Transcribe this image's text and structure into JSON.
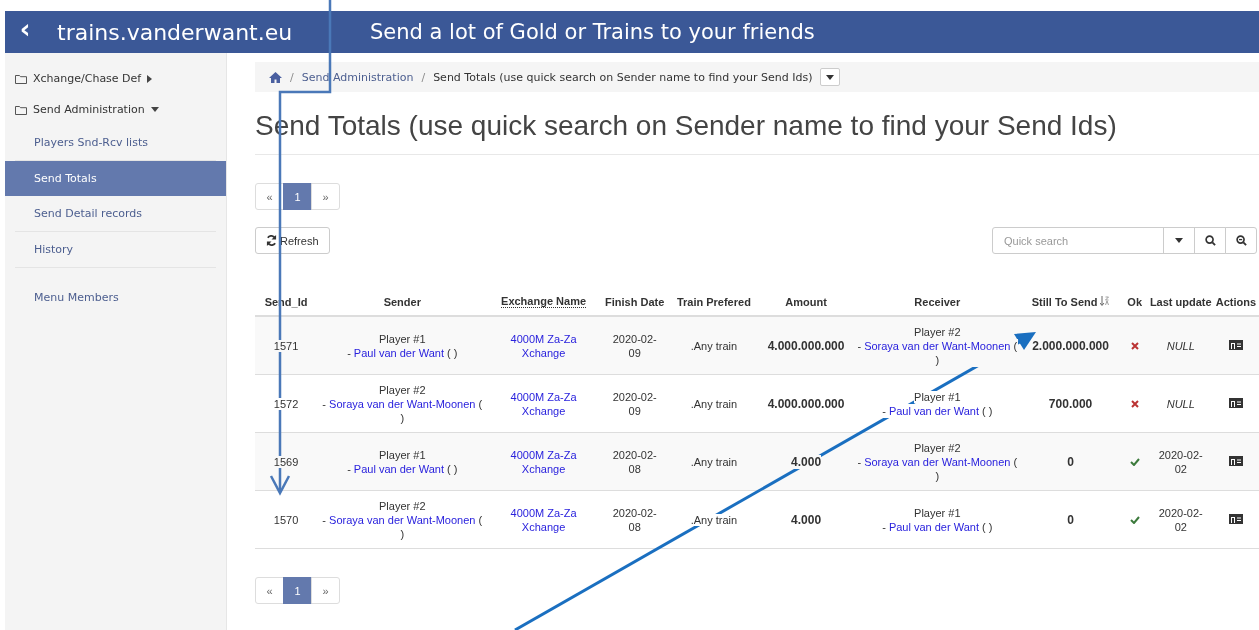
{
  "topbar": {
    "back": "‹",
    "site": "trains.vanderwant.eu",
    "tagline": "Send a lot of Gold or Trains to your friends"
  },
  "sidebar": {
    "items": [
      {
        "label": "Xchange/Chase Def",
        "expanded": false
      },
      {
        "label": "Send Administration",
        "expanded": true,
        "children": [
          {
            "label": "Players Snd-Rcv lists",
            "selected": false
          },
          {
            "label": "Send Totals",
            "selected": true
          },
          {
            "label": "Send Detail records",
            "selected": false
          },
          {
            "label": "History",
            "selected": false
          },
          {
            "label": "Menu Members",
            "selected": false
          }
        ]
      }
    ]
  },
  "breadcrumb": {
    "separator": "/",
    "items": [
      "Send Administration",
      "Send Totals (use quick search on Sender name to find your Send Ids)"
    ]
  },
  "page_title": "Send Totals (use quick search on Sender name to find your Send Ids)",
  "pager_top": [
    {
      "label": "«",
      "selected": false
    },
    {
      "label": "1",
      "selected": true
    },
    {
      "label": "»",
      "selected": false
    }
  ],
  "refresh": "Refresh",
  "search": {
    "placeholder": "Quick search"
  },
  "table": {
    "columns": [
      {
        "label": "Send_Id",
        "kind": "plain"
      },
      {
        "label": "Sender",
        "kind": "plain"
      },
      {
        "label": "Exchange Name",
        "kind": "dotted"
      },
      {
        "label": "Finish Date",
        "kind": "plain"
      },
      {
        "label": "Train Prefered",
        "kind": "plain"
      },
      {
        "label": "Amount",
        "kind": "plain"
      },
      {
        "label": "Receiver",
        "kind": "plain"
      },
      {
        "label": "Still To Send",
        "kind": "sorted"
      },
      {
        "label": "Ok",
        "kind": "plain"
      },
      {
        "label": "Last update",
        "kind": "plain"
      },
      {
        "label": "Actions",
        "kind": "plain"
      }
    ],
    "rows": [
      {
        "id": "1571",
        "sender": {
          "player": "Player #1",
          "dash": "-",
          "name": "Paul van der Want",
          "suffix": "( )"
        },
        "exchange": "4000M Za-Za Xchange",
        "finish": "2020-02-09",
        "train": ".Any train",
        "amount": "4.000.000.000",
        "receiver": {
          "player": "Player #2",
          "dash": "-",
          "name": "Soraya van der Want-Moonen",
          "suffix": "( )"
        },
        "still": "2.000.000.000",
        "ok": false,
        "last_update": {
          "text": "NULL",
          "kind": "null"
        }
      },
      {
        "id": "1572",
        "sender": {
          "player": "Player #2",
          "dash": "-",
          "name": "Soraya van der Want-Moonen",
          "suffix": "( )"
        },
        "exchange": "4000M Za-Za Xchange",
        "finish": "2020-02-09",
        "train": ".Any train",
        "amount": "4.000.000.000",
        "receiver": {
          "player": "Player #1",
          "dash": "-",
          "name": "Paul van der Want",
          "suffix": "( )"
        },
        "still": "700.000",
        "ok": false,
        "last_update": {
          "text": "NULL",
          "kind": "null"
        }
      },
      {
        "id": "1569",
        "sender": {
          "player": "Player #1",
          "dash": "-",
          "name": "Paul van der Want",
          "suffix": "( )"
        },
        "exchange": "4000M Za-Za Xchange",
        "finish": "2020-02-08",
        "train": ".Any train",
        "amount": "4.000",
        "receiver": {
          "player": "Player #2",
          "dash": "-",
          "name": "Soraya van der Want-Moonen",
          "suffix": "( )"
        },
        "still": "0",
        "ok": true,
        "last_update": {
          "text": "2020-02-02",
          "kind": "date"
        }
      },
      {
        "id": "1570",
        "sender": {
          "player": "Player #2",
          "dash": "-",
          "name": "Soraya van der Want-Moonen",
          "suffix": "( )"
        },
        "exchange": "4000M Za-Za Xchange",
        "finish": "2020-02-08",
        "train": ".Any train",
        "amount": "4.000",
        "receiver": {
          "player": "Player #1",
          "dash": "-",
          "name": "Paul van der Want",
          "suffix": "( )"
        },
        "still": "0",
        "ok": true,
        "last_update": {
          "text": "2020-02-02",
          "kind": "date"
        }
      }
    ]
  },
  "pager_bottom": [
    {
      "label": "«",
      "selected": false
    },
    {
      "label": "1",
      "selected": true
    },
    {
      "label": "»",
      "selected": false
    }
  ]
}
